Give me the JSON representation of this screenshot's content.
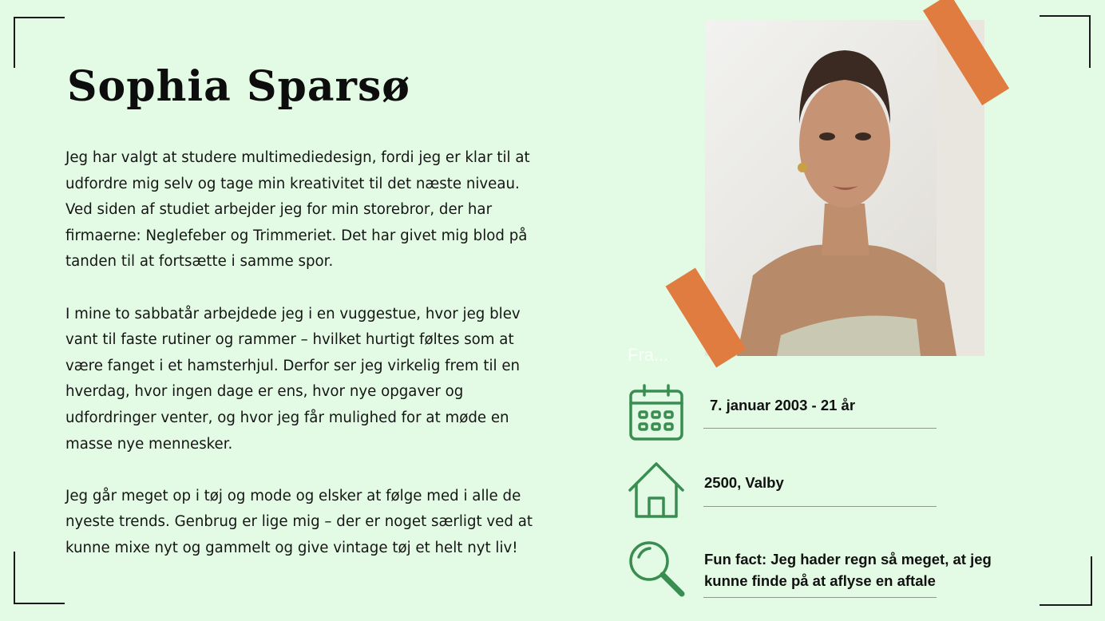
{
  "profile": {
    "name": "Sophia Sparsø",
    "bio": [
      "Jeg har valgt at studere multimediedesign, fordi jeg er klar til at udfordre mig selv og tage min kreativitet til det næste niveau. Ved siden af studiet arbejder jeg for min storebror, der har firmaerne: Neglefeber og Trimmeriet. Det har givet mig blod på tanden til at fortsætte i samme spor.",
      "I mine to sabbatår arbejdede jeg i en vuggestue, hvor jeg blev vant til faste rutiner og rammer – hvilket hurtigt føltes som at være fanget i et hamsterhjul. Derfor ser jeg virkelig frem til en hverdag, hvor ingen dage er ens, hvor nye opgaver og udfordringer venter, og hvor jeg får mulighed for at møde en masse nye mennesker.",
      "Jeg går meget op i tøj og mode og elsker at følge med i alle de nyeste trends. Genbrug er lige mig – der er noget særligt ved at kunne mixe nyt og gammelt og give vintage tøj et helt nyt liv!"
    ]
  },
  "ghost_label": "Fra...",
  "info": {
    "birthday": "7. januar 2003 - 21 år",
    "address": "2500, Valby",
    "fun_fact": "Fun fact: Jeg hader regn så meget, at jeg kunne finde på at aflyse en aftale"
  },
  "icons": {
    "birthday": "calendar-icon",
    "address": "house-icon",
    "fun_fact": "magnifier-icon"
  },
  "colors": {
    "background": "#e3fbe4",
    "accent_green": "#3a8d50",
    "tape_orange": "#e07c3f"
  }
}
